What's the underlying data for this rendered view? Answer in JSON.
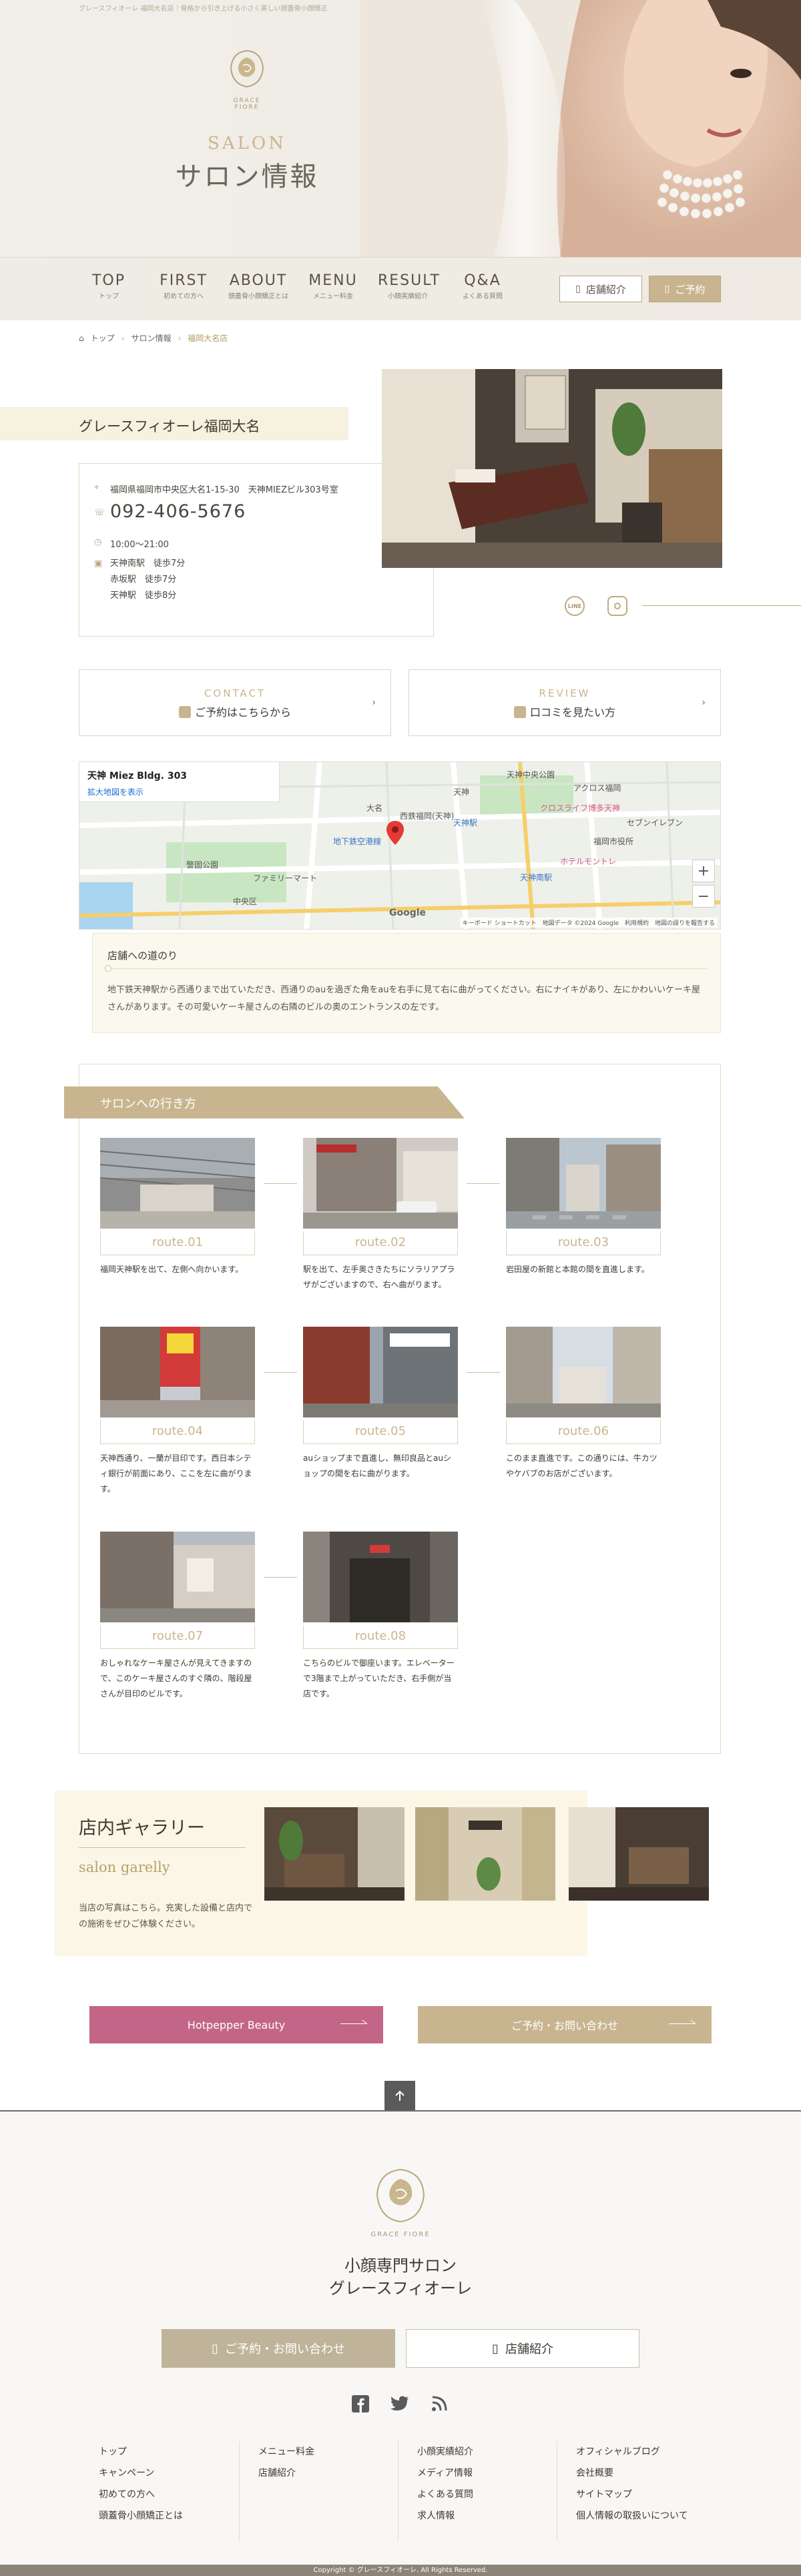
{
  "header": {
    "tagline": "グレースフィオーレ 福岡大名店｜骨格から引き上げる小さく美しい頭蓋骨小顔矯正",
    "logo_text": "GRACE FIORE",
    "page_sub": "SALON",
    "page_title": "サロン情報"
  },
  "nav": {
    "items": [
      {
        "en": "TOP",
        "ja": "トップ"
      },
      {
        "en": "FIRST",
        "ja": "初めての方へ"
      },
      {
        "en": "ABOUT",
        "ja": "頭蓋骨小顔矯正とは"
      },
      {
        "en": "MENU",
        "ja": "メニュー料金"
      },
      {
        "en": "RESULT",
        "ja": "小顔実績紹介"
      },
      {
        "en": "Q&A",
        "ja": "よくある質問"
      }
    ],
    "shop_button": "店舗紹介",
    "reserve_button": "ご予約"
  },
  "breadcrumb": [
    "トップ",
    "サロン情報",
    "福岡大名店"
  ],
  "shop": {
    "name": "グレースフィオーレ福岡大名",
    "address": "福岡県福岡市中央区大名1-15-30　天神MIEZビル303号室",
    "tel": "092-406-5676",
    "hours": "10:00〜21:00",
    "access": [
      {
        "station": "天神南駅",
        "walk": "徒歩7分"
      },
      {
        "station": "赤坂駅",
        "walk": "徒歩7分"
      },
      {
        "station": "天神駅",
        "walk": "徒歩8分"
      }
    ]
  },
  "cta": {
    "contact_en": "CONTACT",
    "contact_ja": "ご予約はこちらから",
    "review_en": "REVIEW",
    "review_ja": "口コミを見たい方"
  },
  "map": {
    "place": "天神 Miez Bldg. 303",
    "link": "拡大地図を表示",
    "labels": [
      "天神中央公園",
      "天神",
      "大名",
      "西鉄福岡(天神)",
      "天神駅",
      "クロスライフ博多天神",
      "セブンイレブン",
      "福岡市役所",
      "天神南駅",
      "ホテルモントレ",
      "中央区",
      "警固公園",
      "ファミリーマート",
      "アクロス福岡",
      "地下鉄空港線"
    ],
    "footer": "キーボード ショートカット　地図データ ©2024 Google　利用規約　地図の誤りを報告する"
  },
  "directions": {
    "title": "店舗への道のり",
    "text": "地下鉄天神駅から西通りまで出ていただき、西通りのauを過ぎた角をauを右手に見て右に曲がってください。右にナイキがあり、左にかわいいケーキ屋さんがあります。その可愛いケーキ屋さんの右隣のビルの奥のエントランスの左です。"
  },
  "route": {
    "title": "サロンへの行き方",
    "steps": [
      {
        "label": "route.01",
        "text": "福岡天神駅を出て、左側へ向かいます。"
      },
      {
        "label": "route.02",
        "text": "駅を出て、左手奥さきたちにソラリアプラザがございますので、右へ曲がります。"
      },
      {
        "label": "route.03",
        "text": "岩田屋の新館と本館の間を直進します。"
      },
      {
        "label": "route.04",
        "text": "天神西通り、一蘭が目印です。西日本シティ銀行が前面にあり、ここを左に曲がります。"
      },
      {
        "label": "route.05",
        "text": "auショップまで直進し、無印良品とauショップの間を右に曲がります。"
      },
      {
        "label": "route.06",
        "text": "このまま直進です。この通りには、牛カツやケバブのお店がございます。"
      },
      {
        "label": "route.07",
        "text": "おしゃれなケーキ屋さんが見えてきますので、このケーキ屋さんのすぐ隣の、階段屋さんが目印のビルです。"
      },
      {
        "label": "route.08",
        "text": "こちらのビルで御座います。エレベーターで3階まで上がっていただき、右手側が当店です。"
      }
    ]
  },
  "gallery": {
    "title": "店内ギャラリー",
    "subtitle": "salon garelly",
    "text": "当店の写真はこちら。充実した設備と店内での施術をぜひご体験ください。"
  },
  "buttons": {
    "hotpepper": "Hotpepper Beauty",
    "contact": "ご予約・お問い合わせ"
  },
  "footer": {
    "logo_text": "GRACE FIORE",
    "title_line1": "小顔専門サロン",
    "title_line2": "グレースフィオーレ",
    "reserve_button": "ご予約・お問い合わせ",
    "shop_button": "店舗紹介",
    "col1": [
      "トップ",
      "キャンペーン",
      "初めての方へ",
      "頭蓋骨小顔矯正とは"
    ],
    "col2": [
      "メニュー料金",
      "店舗紹介"
    ],
    "col3": [
      "小顔実績紹介",
      "メディア情報",
      "よくある質問",
      "求人情報"
    ],
    "col4": [
      "オフィシャルブログ",
      "会社概要",
      "サイトマップ",
      "個人情報の取扱いについて"
    ],
    "copyright": "Copyright © グレースフィオーレ. All Rights Reserved."
  },
  "colors": {
    "gold": "#c8b590",
    "pink": "#c36586",
    "dark": "#3e3a33"
  }
}
